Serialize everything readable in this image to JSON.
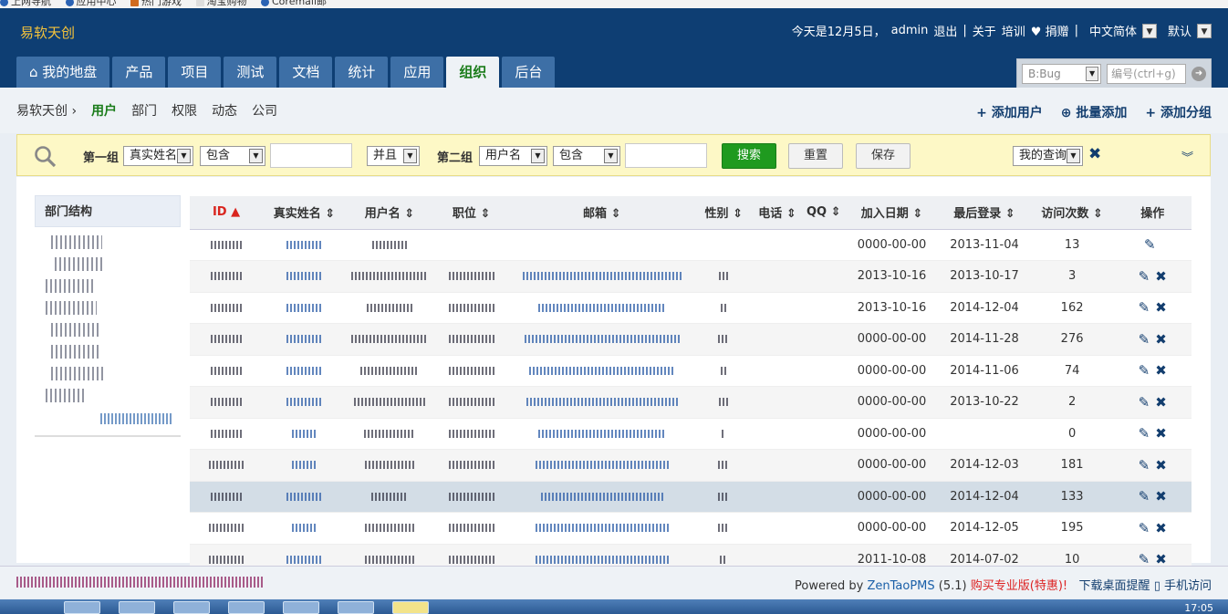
{
  "browser_bar": {
    "items": [
      "上网导航",
      "应用中心",
      "热门游戏",
      "淘宝购物",
      "Coremail邮"
    ]
  },
  "header": {
    "brand": "易软天创",
    "today": "今天是12月5日，",
    "user": "admin",
    "logout": "退出",
    "about": "关于",
    "training": "培训",
    "donate": "♥ 捐赠",
    "language": "中文简体",
    "theme": "默认"
  },
  "nav": {
    "tabs": [
      "我的地盘",
      "产品",
      "项目",
      "测试",
      "文档",
      "统计",
      "应用",
      "组织",
      "后台"
    ],
    "active": "组织"
  },
  "quick_search": {
    "type": "B:Bug",
    "placeholder": "编号(ctrl+g)"
  },
  "subnav": {
    "root": "易软天创",
    "items": [
      "用户",
      "部门",
      "权限",
      "动态",
      "公司"
    ],
    "active": "用户"
  },
  "actions": {
    "add_user": "添加用户",
    "batch_add": "批量添加",
    "add_group": "添加分组"
  },
  "search": {
    "group1_label": "第一组",
    "g1_field": "真实姓名",
    "g1_op": "包含",
    "g1_value": "",
    "and_or": "并且",
    "group2_label": "第二组",
    "g2_field": "用户名",
    "g2_op": "包含",
    "g2_value": "",
    "search_btn": "搜索",
    "reset_btn": "重置",
    "save_btn": "保存",
    "my_query": "我的查询"
  },
  "dept_tree": {
    "title": "部门结构"
  },
  "table": {
    "columns": [
      "ID",
      "真实姓名",
      "用户名",
      "职位",
      "邮箱",
      "性别",
      "电话",
      "QQ",
      "加入日期",
      "最后登录",
      "访问次数",
      "操作"
    ],
    "rows": [
      {
        "join": "0000-00-00",
        "last": "2013-11-04",
        "visits": "13"
      },
      {
        "join": "2013-10-16",
        "last": "2013-10-17",
        "visits": "3"
      },
      {
        "join": "2013-10-16",
        "last": "2014-12-04",
        "visits": "162"
      },
      {
        "join": "0000-00-00",
        "last": "2014-11-28",
        "visits": "276"
      },
      {
        "join": "0000-00-00",
        "last": "2014-11-06",
        "visits": "74"
      },
      {
        "join": "0000-00-00",
        "last": "2013-10-22",
        "visits": "2"
      },
      {
        "join": "0000-00-00",
        "last": "",
        "visits": "0"
      },
      {
        "join": "0000-00-00",
        "last": "2014-12-03",
        "visits": "181"
      },
      {
        "join": "0000-00-00",
        "last": "2014-12-04",
        "visits": "133"
      },
      {
        "join": "0000-00-00",
        "last": "2014-12-05",
        "visits": "195"
      },
      {
        "join": "2011-10-08",
        "last": "2014-07-02",
        "visits": "10"
      }
    ]
  },
  "footer": {
    "powered": "Powered by",
    "zentao": "ZenTaoPMS",
    "version": "(5.1)",
    "buy": "购买专业版(特惠)!",
    "desktop": "下载桌面提醒",
    "mobile": "手机访问"
  },
  "taskbar": {
    "clock": "17:05"
  },
  "colors": {
    "header": "#0e3e73",
    "accent": "#1a7c1a",
    "search_bg": "#fdf8c6",
    "search_btn": "#1f9a1f",
    "link": "#123d6e"
  }
}
